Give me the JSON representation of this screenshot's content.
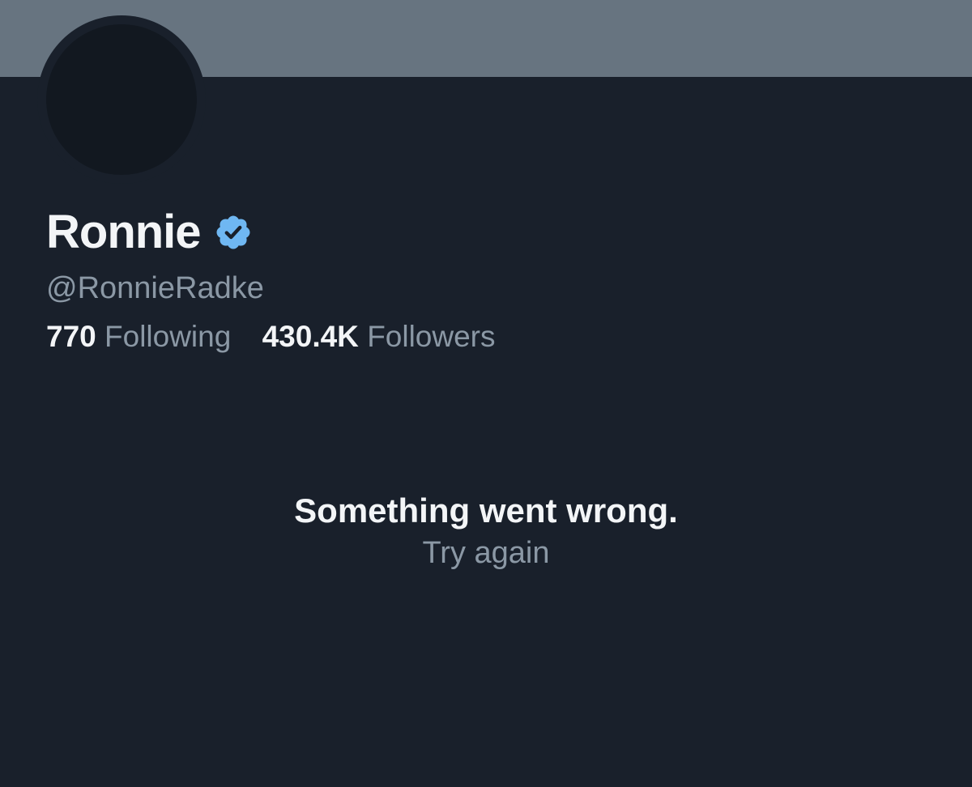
{
  "profile": {
    "display_name": "Ronnie",
    "verified_icon": "verified-badge-icon",
    "handle": "@RonnieRadke",
    "following_count": "770",
    "following_label": "Following",
    "followers_count": "430.4K",
    "followers_label": "Followers"
  },
  "error": {
    "title": "Something went wrong.",
    "retry_label": "Try again"
  },
  "colors": {
    "background": "#19202b",
    "banner": "#677480",
    "avatar": "#121820",
    "verified": "#6fb7f2",
    "primary_text": "#f3f5f7",
    "secondary_text": "#8b98a5"
  }
}
